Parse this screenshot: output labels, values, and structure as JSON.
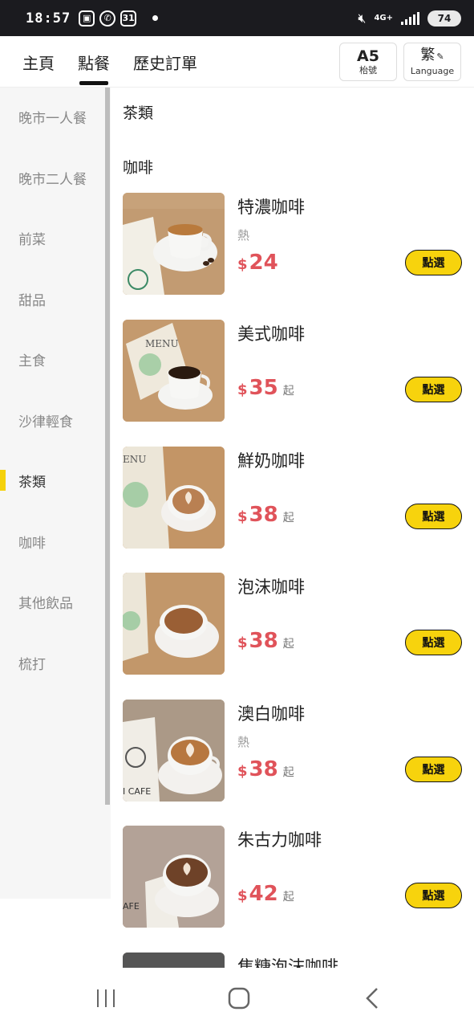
{
  "status_bar": {
    "time": "18:57",
    "calendar_day": "31",
    "network": "4G+",
    "battery": "74"
  },
  "header": {
    "tabs": [
      {
        "label": "主頁",
        "active": false
      },
      {
        "label": "點餐",
        "active": true
      },
      {
        "label": "歷史訂單",
        "active": false
      }
    ],
    "table_button": {
      "number": "A5",
      "label": "枱號"
    },
    "language_button": {
      "char": "繁",
      "label": "Language"
    }
  },
  "sidebar": {
    "items": [
      {
        "label": "晚市一人餐",
        "active": false
      },
      {
        "label": "晚市二人餐",
        "active": false
      },
      {
        "label": "前菜",
        "active": false
      },
      {
        "label": "甜品",
        "active": false
      },
      {
        "label": "主食",
        "active": false
      },
      {
        "label": "沙律輕食",
        "active": false
      },
      {
        "label": "茶類",
        "active": true
      },
      {
        "label": "咖啡",
        "active": false
      },
      {
        "label": "其他飲品",
        "active": false
      },
      {
        "label": "梳打",
        "active": false
      }
    ]
  },
  "content": {
    "sections": [
      {
        "title": "茶類"
      },
      {
        "title": "咖啡"
      }
    ],
    "items": [
      {
        "name": "特濃咖啡",
        "sub": "熱",
        "currency": "$",
        "price": "24",
        "suffix": "",
        "button": "點選",
        "image": "espresso-cup"
      },
      {
        "name": "美式咖啡",
        "sub": "",
        "currency": "$",
        "price": "35",
        "suffix": "起",
        "button": "點選",
        "image": "americano-cup"
      },
      {
        "name": "鮮奶咖啡",
        "sub": "",
        "currency": "$",
        "price": "38",
        "suffix": "起",
        "button": "點選",
        "image": "latte-cup"
      },
      {
        "name": "泡沫咖啡",
        "sub": "",
        "currency": "$",
        "price": "38",
        "suffix": "起",
        "button": "點選",
        "image": "cappuccino-cup"
      },
      {
        "name": "澳白咖啡",
        "sub": "熱",
        "currency": "$",
        "price": "38",
        "suffix": "起",
        "button": "點選",
        "image": "flat-white-cup"
      },
      {
        "name": "朱古力咖啡",
        "sub": "",
        "currency": "$",
        "price": "42",
        "suffix": "起",
        "button": "點選",
        "image": "mocha-cup"
      },
      {
        "name": "焦糖泡沫咖啡",
        "sub": "",
        "currency": "",
        "price": "",
        "suffix": "",
        "button": "",
        "image": "caramel-cup"
      }
    ]
  },
  "colors": {
    "accent_yellow": "#f7d30d",
    "price_red": "#e0535a",
    "status_bar": "#1b1b1f"
  }
}
